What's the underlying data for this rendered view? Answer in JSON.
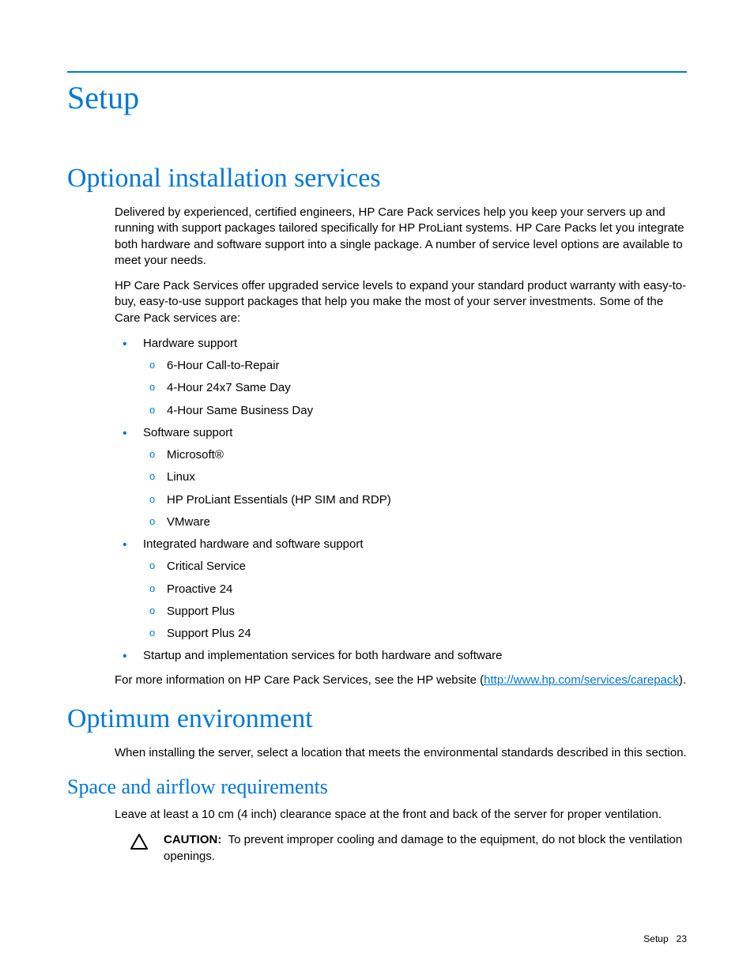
{
  "chapter_title": "Setup",
  "section_services": {
    "title": "Optional installation services",
    "para1": "Delivered by experienced, certified engineers, HP Care Pack services help you keep your servers up and running with support packages tailored specifically for HP ProLiant systems. HP Care Packs let you integrate both hardware and software support into a single package. A number of service level options are available to meet your needs.",
    "para2": "HP Care Pack Services offer upgraded service levels to expand your standard product warranty with easy-to-buy, easy-to-use support packages that help you make the most of your server investments. Some of the Care Pack services are:",
    "bullets": {
      "hw_label": "Hardware support",
      "hw_items": {
        "a": "6-Hour Call-to-Repair",
        "b": "4-Hour 24x7 Same Day",
        "c": "4-Hour Same Business Day"
      },
      "sw_label": "Software support",
      "sw_items": {
        "a": "Microsoft®",
        "b": "Linux",
        "c": "HP ProLiant Essentials (HP SIM and RDP)",
        "d": "VMware"
      },
      "int_label": "Integrated hardware and software support",
      "int_items": {
        "a": "Critical Service",
        "b": "Proactive 24",
        "c": "Support Plus",
        "d": "Support Plus 24"
      },
      "startup_label": "Startup and implementation services for both hardware and software"
    },
    "more_prefix": "For more information on HP Care Pack Services, see the HP website (",
    "more_link": "http://www.hp.com/services/carepack",
    "more_suffix": ")."
  },
  "section_env": {
    "title": "Optimum environment",
    "para1": "When installing the server, select a location that meets the environmental standards described in this section."
  },
  "section_space": {
    "title": "Space and airflow requirements",
    "para1": "Leave at least a 10 cm (4 inch) clearance space at the front and back of the server for proper ventilation.",
    "caution_label": "CAUTION:",
    "caution_text": "To prevent improper cooling and damage to the equipment, do not block the ventilation openings."
  },
  "footer": {
    "section": "Setup",
    "page": "23"
  }
}
